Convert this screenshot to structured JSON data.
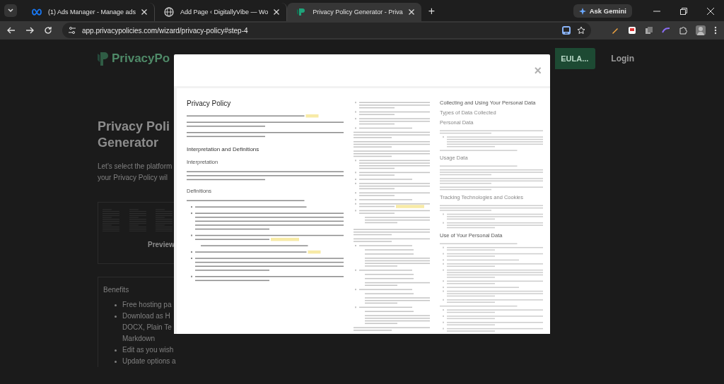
{
  "browser": {
    "tabs": [
      {
        "title": "(1) Ads Manager - Manage ads",
        "selected": false
      },
      {
        "title": "Add Page ‹ DigitallyVibe — Wo",
        "selected": false
      },
      {
        "title": "Privacy Policy Generator - Priva",
        "selected": true
      }
    ],
    "new_tab": "+",
    "gemini": "Ask Gemini",
    "url": "app.privacypolicies.com/wizard/privacy-policy#step-4"
  },
  "page": {
    "logo": "PrivacyPo",
    "nav_button": "EULA...",
    "login": "Login",
    "heading": [
      "Privacy Poli",
      "Generator"
    ],
    "intro": [
      "Let's select the platform",
      "your Privacy Policy wil"
    ],
    "preview_label": "Preview",
    "benefits_title": "Benefits",
    "benefits": [
      [
        "Free hosting pa"
      ],
      [
        "Download as H",
        "DOCX, Plain Te",
        "Markdown"
      ],
      [
        "Edit as you wish"
      ],
      [
        "Update options a"
      ]
    ]
  },
  "modal": {
    "close": "×",
    "document": {
      "left": [
        {
          "kind": "title",
          "text": "Privacy Policy"
        },
        {
          "kind": "heading",
          "text": "Interpretation and Definitions"
        },
        {
          "kind": "subheading",
          "text": "Interpretation"
        },
        {
          "kind": "subheading",
          "text": "Definitions"
        }
      ],
      "right": [
        {
          "kind": "heading",
          "text": "Collecting and Using Your Personal Data"
        },
        {
          "kind": "subheading",
          "text": "Types of Data Collected"
        },
        {
          "kind": "subheading",
          "text": "Personal Data"
        },
        {
          "kind": "subheading",
          "text": "Usage Data"
        },
        {
          "kind": "subheading",
          "text": "Tracking Technologies and Cookies"
        },
        {
          "kind": "heading",
          "text": "Use of Your Personal Data"
        }
      ]
    }
  }
}
